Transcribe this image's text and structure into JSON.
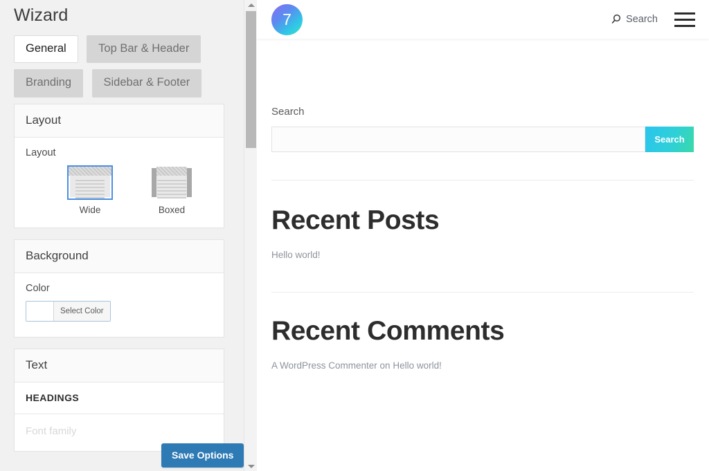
{
  "wizard": {
    "title": "Wizard",
    "tabs": [
      {
        "label": "General",
        "active": true
      },
      {
        "label": "Top Bar & Header",
        "active": false
      },
      {
        "label": "Branding",
        "active": false
      },
      {
        "label": "Sidebar & Footer",
        "active": false
      }
    ],
    "panels": {
      "layout": {
        "heading": "Layout",
        "field_label": "Layout",
        "options": [
          {
            "caption": "Wide",
            "selected": true
          },
          {
            "caption": "Boxed",
            "selected": false
          }
        ]
      },
      "background": {
        "heading": "Background",
        "field_label": "Color",
        "select_color_label": "Select Color",
        "swatch_color": "#ffffff"
      },
      "text": {
        "heading": "Text",
        "subheading": "HEADINGS",
        "font_family_label": "Font family"
      }
    },
    "save_label": "Save Options",
    "save_color": "#2e7ab5"
  },
  "preview": {
    "header": {
      "logo_text": "7",
      "search_label": "Search",
      "menu_icon": "hamburger-icon"
    },
    "search_widget": {
      "title": "Search",
      "input_value": "",
      "input_placeholder": "",
      "button_label": "Search"
    },
    "recent_posts": {
      "title": "Recent Posts",
      "items": [
        "Hello world!"
      ]
    },
    "recent_comments": {
      "title": "Recent Comments",
      "items": [
        "A WordPress Commenter on Hello world!"
      ]
    }
  }
}
